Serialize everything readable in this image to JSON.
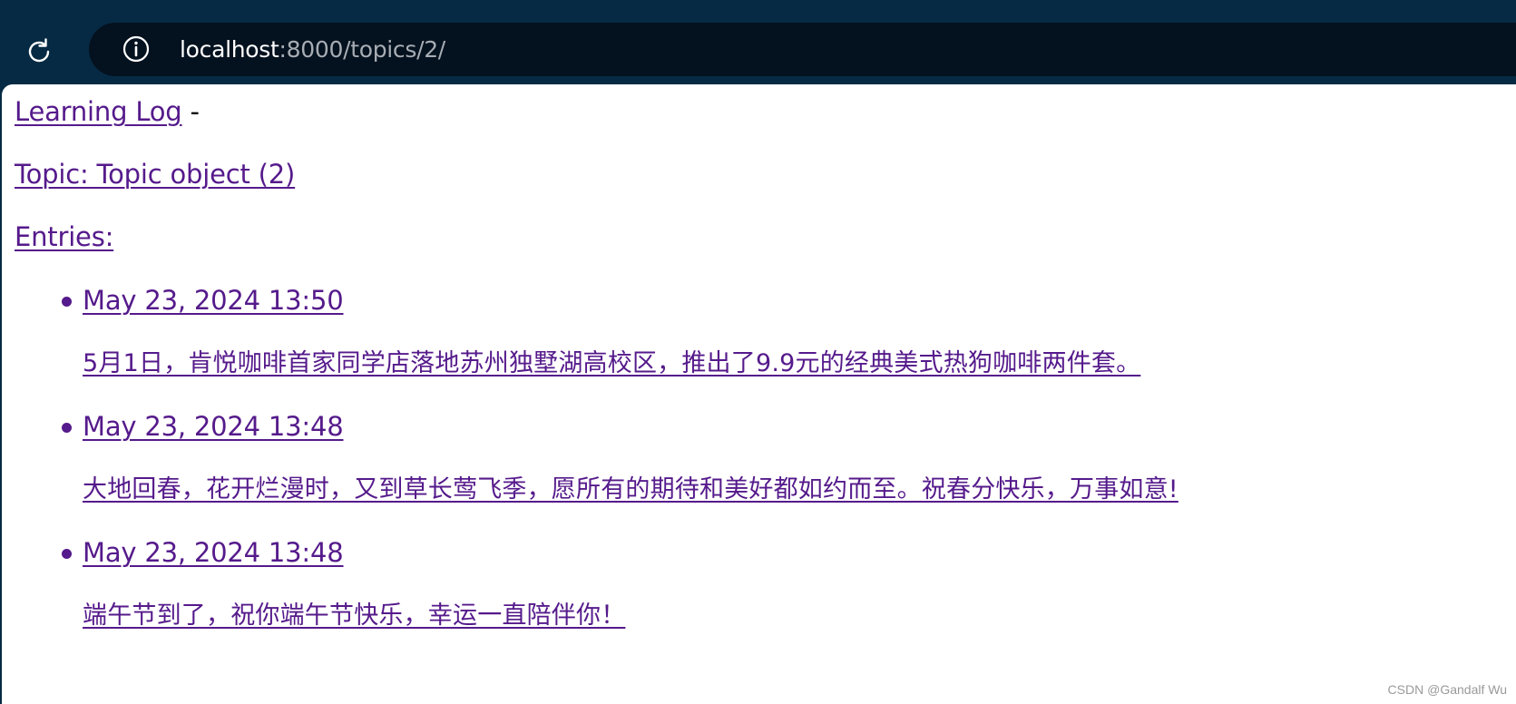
{
  "browser": {
    "url_host": "localhost",
    "url_rest": ":8000/topics/2/",
    "icons": {
      "reload": "reload-icon",
      "info": "info-icon"
    },
    "colors": {
      "chrome_bg": "#062a44",
      "address_bg": "#04111e",
      "url_host": "#ffffff",
      "url_rest": "#a7adb4"
    }
  },
  "page": {
    "header_link": "Learning Log",
    "header_separator": "-",
    "topic_heading": "Topic: Topic object (2)",
    "entries_heading": "Entries:",
    "link_color": "#551a8b",
    "entries": [
      {
        "date": "May 23, 2024 13:50",
        "text": "5月1日，肯悦咖啡首家同学店落地苏州独墅湖高校区，推出了9.9元的经典美式热狗咖啡两件套。"
      },
      {
        "date": "May 23, 2024 13:48",
        "text": "大地回春，花开烂漫时，又到草长莺飞季，愿所有的期待和美好都如约而至。祝春分快乐，万事如意!"
      },
      {
        "date": "May 23, 2024 13:48",
        "text": "端午节到了，祝你端午节快乐，幸运一直陪伴你！"
      }
    ]
  },
  "watermark": "CSDN @Gandalf Wu"
}
